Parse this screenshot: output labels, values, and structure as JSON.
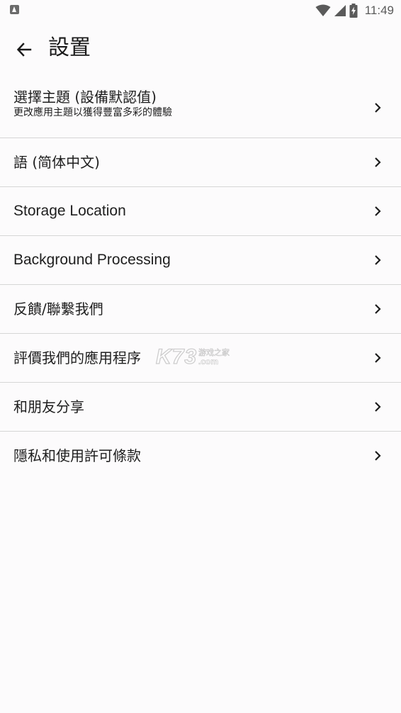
{
  "status_bar": {
    "time": "11:49",
    "icons": [
      "app-notification-icon",
      "wifi-icon",
      "cell-signal-icon",
      "battery-charging-icon"
    ]
  },
  "app_bar": {
    "title": "設置",
    "back_icon": "arrow-left-icon"
  },
  "settings": {
    "theme": {
      "title": "選擇主題 (設備默認值)",
      "subtitle": "更改應用主題以獲得豐富多彩的體驗"
    },
    "language": {
      "label": "語 (简体中文)"
    },
    "storage": {
      "label": "Storage Location"
    },
    "background": {
      "label": "Background Processing"
    },
    "feedback": {
      "label": "反饋/聯繫我們"
    },
    "rate": {
      "label": "評價我們的應用程序"
    },
    "share": {
      "label": "和朋友分享"
    },
    "privacy": {
      "label": "隱私和使用許可條款"
    }
  },
  "watermark": {
    "main": "K73",
    "cn": "游戏之家",
    "domain": ".com"
  },
  "colors": {
    "background": "#fcfbfc",
    "text": "#1e1e1e",
    "divider": "#d6d6d6",
    "status_icon": "#5a5a5a"
  }
}
